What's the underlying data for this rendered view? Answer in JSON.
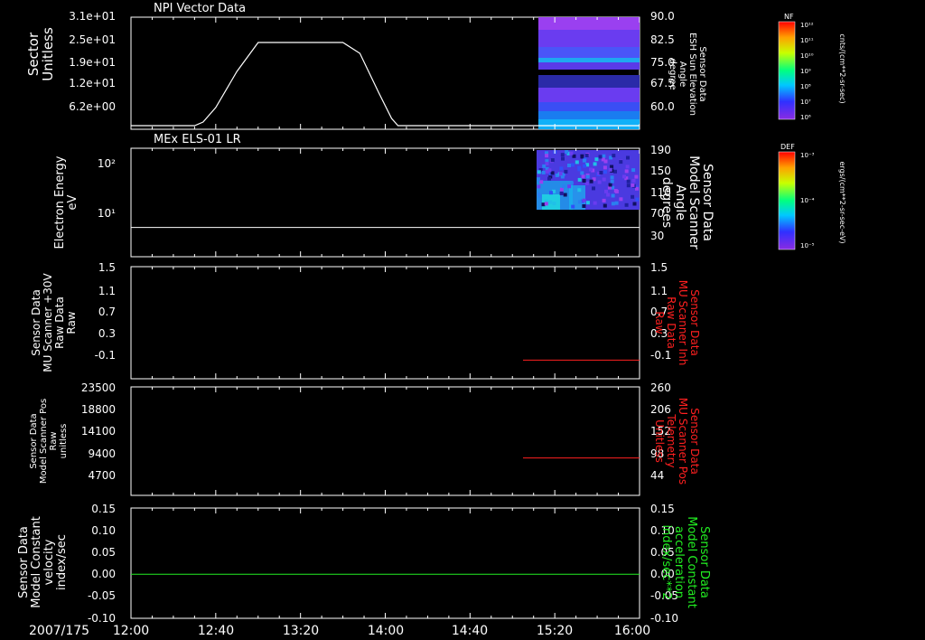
{
  "date_label": "2007/175",
  "time_ticks": [
    "12:00",
    "12:40",
    "13:20",
    "14:00",
    "14:40",
    "15:20",
    "16:00"
  ],
  "panels": [
    {
      "id": "npi",
      "title": "NPI Vector Data",
      "left_label": [
        "Sector",
        "Unitless"
      ],
      "left_ticks": [
        "3.1e+01",
        "2.5e+01",
        "1.9e+01",
        "1.2e+01",
        "6.2e+00"
      ],
      "right_label": [
        "Sensor Data",
        "ESH Sun Elevation",
        "Angle",
        "degree"
      ],
      "right_label_color": "#ffffff",
      "right_ticks": [
        "90.0",
        "82.5",
        "75.0",
        "67.5",
        "60.0"
      ]
    },
    {
      "id": "els",
      "title": "MEx ELS-01 LR",
      "left_label": [
        "Electron Energy",
        "eV"
      ],
      "left_ticks": [
        "10²",
        "10¹"
      ],
      "right_label": [
        "Sensor Data",
        "Model Scanner",
        "Angle",
        "degrees"
      ],
      "right_label_color": "#ffffff",
      "right_ticks": [
        "190",
        "150",
        "110",
        "70",
        "30"
      ]
    },
    {
      "id": "mu-raw",
      "title": "",
      "left_label": [
        "Sensor Data",
        "MU Scanner +30V",
        "Raw Data",
        "Raw"
      ],
      "left_ticks": [
        "1.5",
        "1.1",
        "0.7",
        "0.3",
        "-0.1"
      ],
      "right_label": [
        "Sensor Data",
        "MU Scanner Inh",
        "Raw Data",
        "Raw"
      ],
      "right_label_color": "#ff2020",
      "right_ticks": [
        "1.5",
        "1.1",
        "0.7",
        "0.3",
        "-0.1"
      ]
    },
    {
      "id": "mu-pos",
      "title": "",
      "left_label": [
        "Sensor Data",
        "Model Scanner Pos",
        "Raw",
        "unitless"
      ],
      "left_ticks": [
        "23500",
        "18800",
        "14100",
        "9400",
        "4700"
      ],
      "right_label": [
        "Sensor Data",
        "MU Scanner Pos",
        "Telemetry",
        "Unitless"
      ],
      "right_label_color": "#ff2020",
      "right_ticks": [
        "260",
        "206",
        "152",
        "98",
        "44"
      ]
    },
    {
      "id": "model-const",
      "title": "",
      "left_label": [
        "Sensor Data",
        "Model Constant",
        "velocity",
        "index/sec"
      ],
      "left_ticks": [
        "0.15",
        "0.10",
        "0.05",
        "0.00",
        "-0.05",
        "-0.10"
      ],
      "right_label": [
        "Sensor Data",
        "Model Constant",
        "acceleration",
        "index/sec**2"
      ],
      "right_label_color": "#22ee22",
      "right_ticks": [
        "0.15",
        "0.10",
        "0.05",
        "0.00",
        "-0.05",
        "-0.10"
      ]
    }
  ],
  "colorbars": [
    {
      "id": "nf",
      "title": "NF",
      "ticks": [
        "10¹²",
        "10¹¹",
        "10¹⁰",
        "10⁹",
        "10⁸",
        "10⁷",
        "10⁶"
      ],
      "unit": "cnts/(cm**2-sr-sec)"
    },
    {
      "id": "def",
      "title": "DEF",
      "ticks": [
        "10⁻³",
        "10⁻⁴",
        "10⁻⁵"
      ],
      "unit": "ergs/(cm**2-sr-sec-eV)"
    }
  ],
  "chart_data": [
    {
      "type": "line",
      "panel": "NPI Vector Data",
      "x_range": [
        "12:00",
        "16:00"
      ],
      "ylim": [
        0,
        31
      ],
      "series": [
        {
          "color": "#ffffff",
          "x": [
            "12:00",
            "12:30",
            "12:34",
            "12:40",
            "12:50",
            "13:00",
            "13:40",
            "13:48",
            "13:57",
            "14:03",
            "14:06",
            "16:00"
          ],
          "values": [
            0,
            0,
            1,
            5,
            15,
            23,
            23,
            20,
            9,
            2,
            0,
            0
          ]
        }
      ],
      "spectrogram_extent": [
        "15:10",
        "16:00"
      ]
    },
    {
      "type": "heatmap",
      "panel": "MEx ELS-01 LR",
      "x_range": [
        "12:00",
        "16:00"
      ],
      "spectrogram_extent": [
        "15:10",
        "16:00"
      ],
      "energy_range_eV": [
        5,
        180
      ],
      "series": [
        {
          "color": "#ffffff",
          "x": [
            "12:00",
            "16:00"
          ],
          "values": [
            20,
            20
          ]
        }
      ]
    },
    {
      "type": "line",
      "panel": "MU Scanner Raw",
      "ylim": [
        -0.3,
        1.5
      ],
      "series": [
        {
          "color": "#ff2020",
          "x": [
            "15:05",
            "16:00"
          ],
          "values": [
            0.0,
            0.0
          ]
        }
      ]
    },
    {
      "type": "line",
      "panel": "MU Scanner Pos",
      "ylim": [
        0,
        23500
      ],
      "series": [
        {
          "color": "#ff2020",
          "x": [
            "15:05",
            "16:00"
          ],
          "values": [
            8100,
            8100
          ]
        }
      ]
    },
    {
      "type": "line",
      "panel": "Model Constant",
      "ylim": [
        -0.1,
        0.15
      ],
      "series": [
        {
          "color": "#22ee22",
          "x": [
            "12:00",
            "16:00"
          ],
          "values": [
            0.0,
            0.0
          ]
        }
      ]
    }
  ]
}
